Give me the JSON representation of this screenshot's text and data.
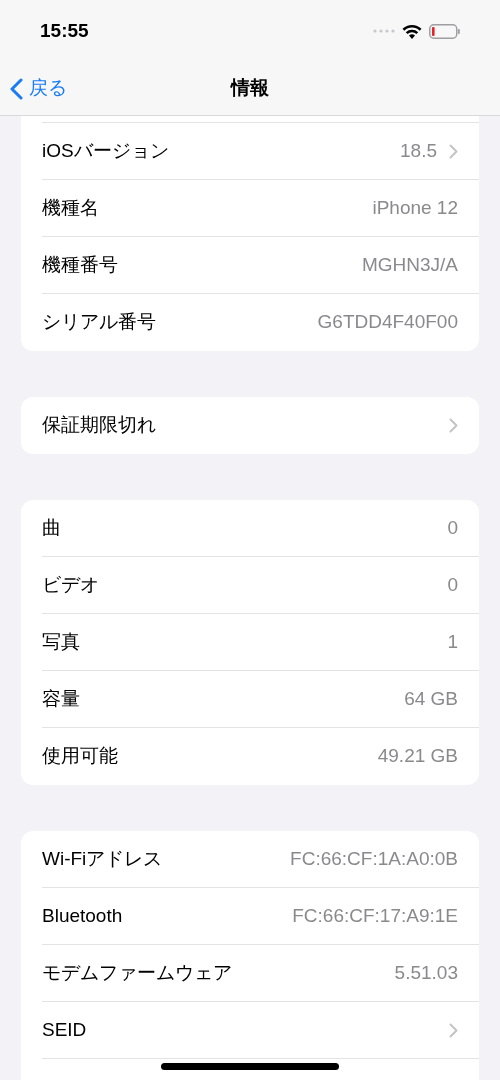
{
  "status_bar": {
    "time": "15:55"
  },
  "nav": {
    "back": "戻る",
    "title": "情報"
  },
  "sections": [
    {
      "rows": [
        {
          "kind": "link",
          "label": "iOSバージョン",
          "value": "18.5"
        },
        {
          "kind": "detail",
          "label": "機種名",
          "value": "iPhone 12"
        },
        {
          "kind": "detail",
          "label": "機種番号",
          "value": "MGHN3J/A"
        },
        {
          "kind": "detail",
          "label": "シリアル番号",
          "value": "G6TDD4F40F00"
        }
      ]
    },
    {
      "rows": [
        {
          "kind": "link",
          "label": "保証期限切れ"
        }
      ]
    },
    {
      "rows": [
        {
          "kind": "detail",
          "label": "曲",
          "value": "0"
        },
        {
          "kind": "detail",
          "label": "ビデオ",
          "value": "0"
        },
        {
          "kind": "detail",
          "label": "写真",
          "value": "1"
        },
        {
          "kind": "detail",
          "label": "容量",
          "value": "64 GB"
        },
        {
          "kind": "detail",
          "label": "使用可能",
          "value": "49.21 GB"
        }
      ]
    },
    {
      "rows": [
        {
          "kind": "detail",
          "label": "Wi-Fiアドレス",
          "value": "FC:66:CF:1A:A0:0B"
        },
        {
          "kind": "detail",
          "label": "Bluetooth",
          "value": "FC:66:CF:17:A9:1E"
        },
        {
          "kind": "detail",
          "label": "モデムファームウェア",
          "value": "5.51.03"
        },
        {
          "kind": "link",
          "label": "SEID"
        }
      ]
    }
  ]
}
